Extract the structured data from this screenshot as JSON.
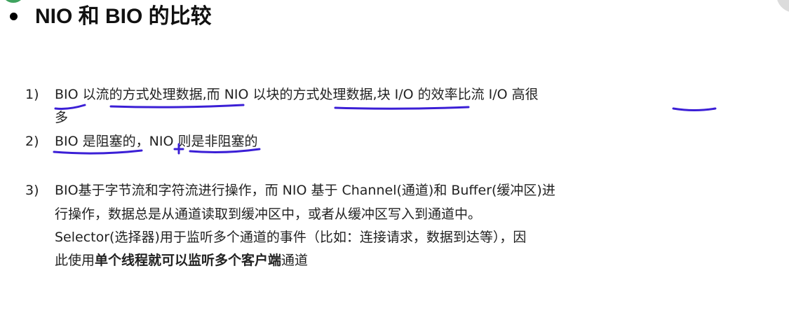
{
  "title": "NIO 和 BIO 的比较",
  "items": [
    {
      "number": "1)",
      "line1": "BIO 以流的方式处理数据,而 NIO 以块的方式处理数据,块 I/O 的效率比流 I/O 高很",
      "line2": "多"
    },
    {
      "number": "2)",
      "line1": "BIO 是阻塞的，NIO 则是非阻塞的"
    },
    {
      "number": "3)",
      "line1": "BIO基于字节流和字符流进行操作，而 NIO 基于 Channel(通道)和 Buffer(缓冲区)进",
      "line2": "行操作，数据总是从通道读取到缓冲区中，或者从缓冲区写入到通道中。",
      "line3": "Selector(选择器)用于监听多个通道的事件（比如：连接请求，数据到达等），因",
      "line4_prefix": "此使用",
      "line4_bold": "单个线程就可以监听多个客户端",
      "line4_suffix": "通道"
    }
  ],
  "colors": {
    "annotation_ink": "#3b1fd6",
    "text": "#222222",
    "title": "#111111",
    "corner_left": "#3fa35f",
    "corner_right": "#dcdcdc"
  },
  "icons": {
    "bullet": "bullet-dot",
    "plus_mark": "plus-annotation-icon"
  }
}
